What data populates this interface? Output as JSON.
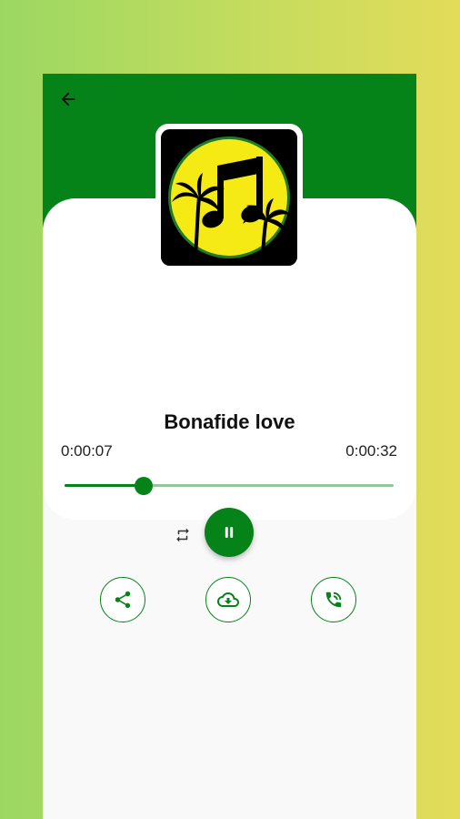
{
  "player": {
    "track_title": "Bonafide love",
    "elapsed_time": "0:00:07",
    "total_time": "0:00:32",
    "progress_fraction": 0.24
  },
  "icons": {
    "back": "arrow-back-icon",
    "repeat": "repeat-icon",
    "pause": "pause-icon",
    "share": "share-icon",
    "download": "cloud-download-icon",
    "call": "phone-ringing-icon"
  },
  "colors": {
    "accent": "#058218",
    "track_inactive": "#95c59b",
    "artwork_yellow": "#f5ea14"
  }
}
